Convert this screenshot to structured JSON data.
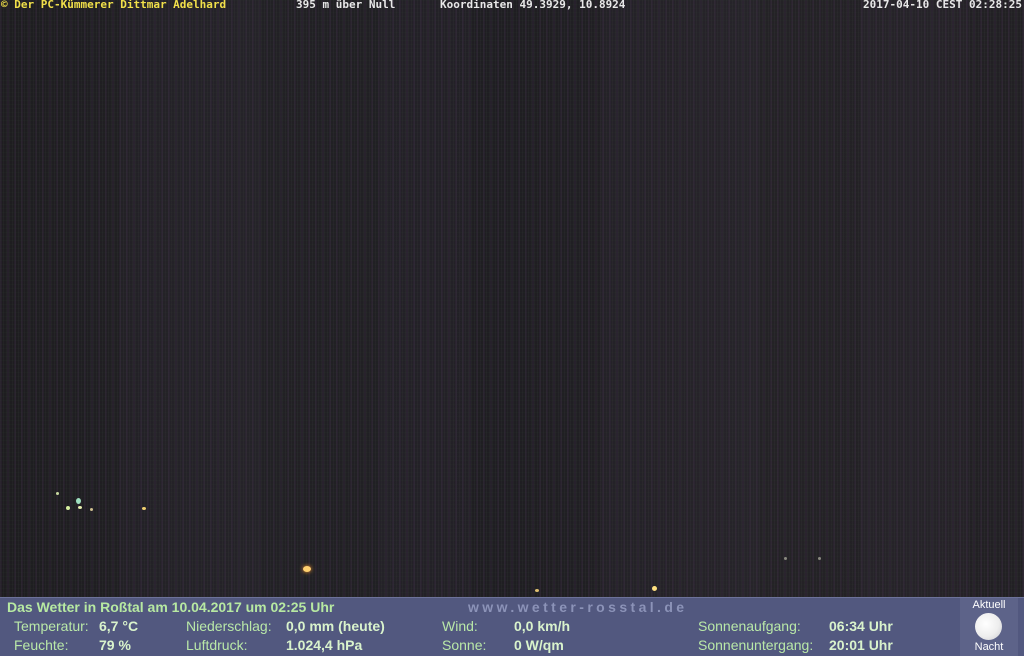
{
  "overlay": {
    "credit": "© Der PC-Kümmerer Dittmar Adelhard",
    "altitude": "395 m über Null",
    "coordinates": "Koordinaten 49.3929, 10.8924",
    "timestamp": "2017-04-10 CEST 02:28:25"
  },
  "panel": {
    "title": "Das Wetter in Roßtal am 10.04.2017 um 02:25 Uhr",
    "site": "www.wetter-rosstal.de",
    "temp_label": "Temperatur:",
    "temp_value": "6,7 °C",
    "humidity_label": "Feuchte:",
    "humidity_value": "79 %",
    "rain_label": "Niederschlag:",
    "rain_value": "0,0 mm (heute)",
    "pressure_label": "Luftdruck:",
    "pressure_value": "1.024,4 hPa",
    "wind_label": "Wind:",
    "wind_value": "0,0 km/h",
    "sun_label": "Sonne:",
    "sun_value": "0 W/qm",
    "sunrise_label": "Sonnenaufgang:",
    "sunrise_value": "06:34 Uhr",
    "sunset_label": "Sonnenuntergang:",
    "sunset_value": "20:01 Uhr",
    "moon_top": "Aktuell",
    "moon_bottom": "Nacht"
  },
  "colors": {
    "credit": "#f1e04a",
    "panel_bg": "#52587f",
    "label_green": "#b9e8a8"
  }
}
